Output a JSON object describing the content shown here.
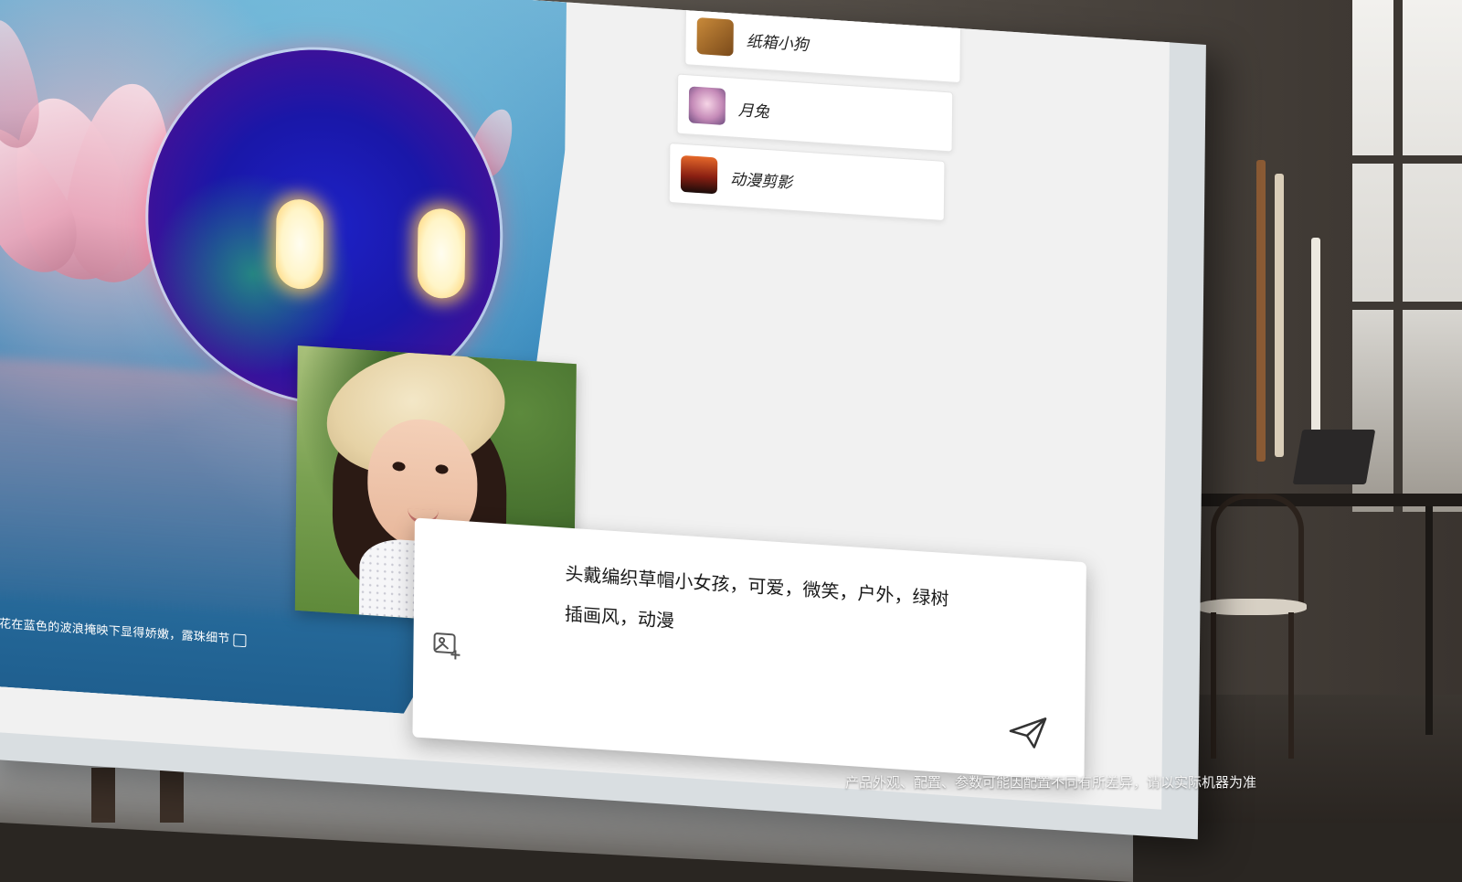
{
  "options": [
    {
      "label": "纸箱小狗",
      "icon": "dog-thumbnail"
    },
    {
      "label": "月兔",
      "icon": "rabbit-thumbnail"
    },
    {
      "label": "动漫剪影",
      "icon": "silhouette-thumbnail"
    }
  ],
  "gallery": {
    "caption": "的莲花在蓝色的波浪掩映下显得娇嫩，露珠细节"
  },
  "prompt": {
    "line1": "头戴编织草帽小女孩，可爱，微笑，户外，绿树",
    "line2": "插画风，动漫"
  },
  "disclaimer": "产品外观、配置、参数可能因配置不同有所差异，请以实际机器为准",
  "colors": {
    "accent": "#1d22c7",
    "orb_edge": "#e0245d",
    "panel_bg": "#f1f1f1"
  }
}
